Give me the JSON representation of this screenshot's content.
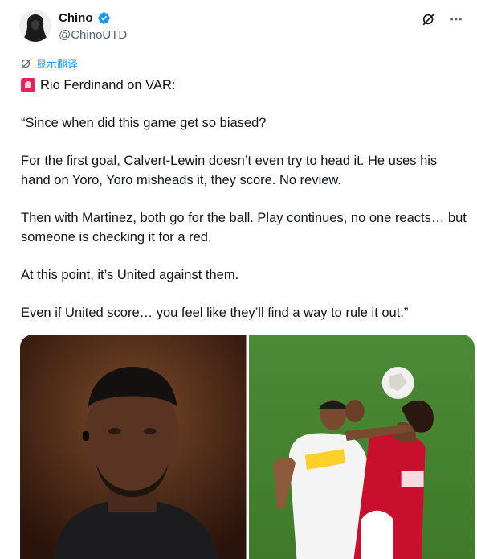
{
  "author": {
    "display_name": "Chino",
    "handle": "@ChinoUTD",
    "verified": true,
    "avatar_icon": "hooded-figure-avatar",
    "verified_color": "#1d9bf0"
  },
  "actions": {
    "grok_icon": "grok-icon",
    "more_icon": "more-dots-icon"
  },
  "translate": {
    "label": "显示翻译",
    "icon": "globe-icon"
  },
  "tweet": {
    "emoji": "siren-emoji",
    "lines": [
      "Rio Ferdinand on VAR:",
      "“Since when did this game get so biased?",
      "For the first goal, Calvert-Lewin doesn’t even try to head it. He uses his hand on Yoro, Yoro misheads it, they score. No review.",
      "Then with Martinez, both go for the ball. Play continues, no one reacts… but someone is checking it for a red.",
      "At this point, it’s United against them.",
      "Even if United score… you feel like they’ll find a way to rule it out.”"
    ]
  },
  "media": [
    {
      "name": "rio-ferdinand-photo"
    },
    {
      "name": "match-header-photo"
    }
  ],
  "colors": {
    "text": "#0f1419",
    "secondary": "#536471",
    "link": "#1d9bf0"
  }
}
